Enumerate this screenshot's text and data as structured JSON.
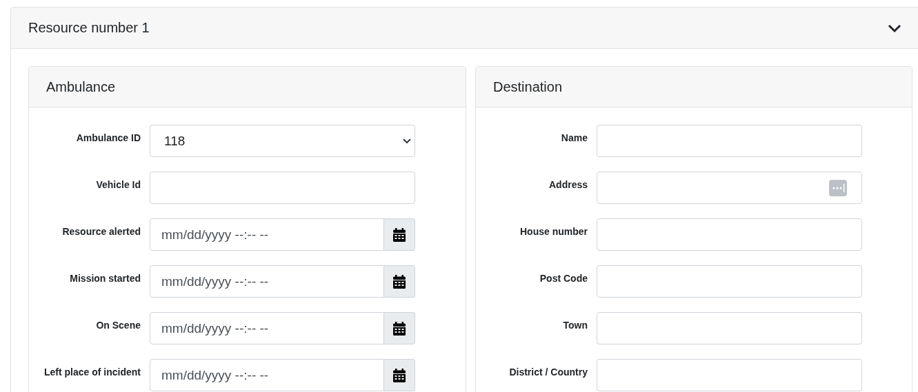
{
  "panel": {
    "title": "Resource number 1",
    "expanded": true
  },
  "sections": [
    {
      "title": "Ambulance",
      "fields": [
        {
          "label": "Ambulance ID",
          "kind": "select",
          "value": "118"
        },
        {
          "label": "Vehicle Id",
          "kind": "text"
        },
        {
          "label": "Resource alerted",
          "kind": "datetime",
          "placeholder": "mm/dd/yyyy --:-- --"
        },
        {
          "label": "Mission started",
          "kind": "datetime",
          "placeholder": "mm/dd/yyyy --:-- --"
        },
        {
          "label": "On Scene",
          "kind": "datetime",
          "placeholder": "mm/dd/yyyy --:-- --"
        },
        {
          "label": "Left place of incident",
          "kind": "datetime",
          "placeholder": "mm/dd/yyyy --:-- --"
        }
      ]
    },
    {
      "title": "Destination",
      "fields": [
        {
          "label": "Name",
          "kind": "text"
        },
        {
          "label": "Address",
          "kind": "address"
        },
        {
          "label": "House number",
          "kind": "text"
        },
        {
          "label": "Post Code",
          "kind": "text"
        },
        {
          "label": "Town",
          "kind": "text"
        },
        {
          "label": "District / Country",
          "kind": "text"
        }
      ]
    }
  ]
}
